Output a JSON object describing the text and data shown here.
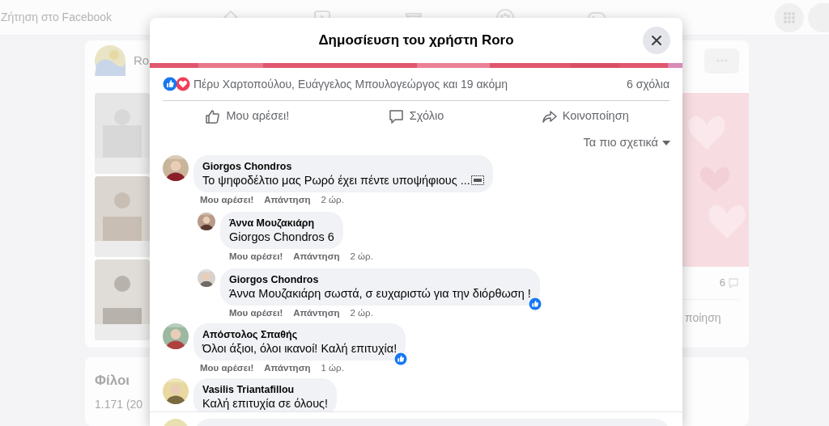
{
  "background": {
    "search_placeholder": "Ζήτηση στο Facebook",
    "post_author": "Ro",
    "comment_count": "6",
    "share_label": "ποίηση",
    "friends_title": "Φίλοι",
    "friends_count": "1.171 (20"
  },
  "dialog": {
    "title": "Δημοσίευση του χρήστη Roro",
    "reactions_summary": "Πέρυ Χαρτοπούλου, Ευάγγελος Μπουλογεώργος και 19 ακόμη",
    "comments_count": "6 σχόλια",
    "actions": [
      {
        "kind": "like",
        "label": "Μου αρέσει!"
      },
      {
        "kind": "comment",
        "label": "Σχόλιο"
      },
      {
        "kind": "share",
        "label": "Κοινοποίηση"
      }
    ],
    "sort": "Τα πιο σχετικά",
    "comments": [
      {
        "author": "Giorgos Chondros",
        "text": "Το ψηφοδέλτιο μας Ρωρό έχει πέντε υποψήφιους ...",
        "trailing_glyph": true,
        "liked": false,
        "like": "Μου αρέσει!",
        "reply": "Απάντηση",
        "time": "2 ώρ.",
        "replies": [
          {
            "author": "Άννα Μουζακιάρη",
            "text": "Giorgos Chondros 6",
            "liked": false,
            "like": "Μου αρέσει!",
            "reply": "Απάντηση",
            "time": "2 ώρ."
          },
          {
            "author": "Giorgos Chondros",
            "text": "Άννα Μουζακιάρη σωστά, σ ευχαριστώ για την διόρθωση !",
            "liked": true,
            "like": "Μου αρέσει!",
            "reply": "Απάντηση",
            "time": "2 ώρ."
          }
        ]
      },
      {
        "author": "Απόστολος Σπαθής",
        "text": "Όλοι άξιοι, όλοι ικανοί! Καλή επιτυχία!",
        "liked": true,
        "like": "Μου αρέσει!",
        "reply": "Απάντηση",
        "time": "1 ώρ."
      },
      {
        "author": "Vasilis Triantafillou",
        "text": "Καλή επιτυχία σε όλους!",
        "liked": false
      }
    ]
  }
}
